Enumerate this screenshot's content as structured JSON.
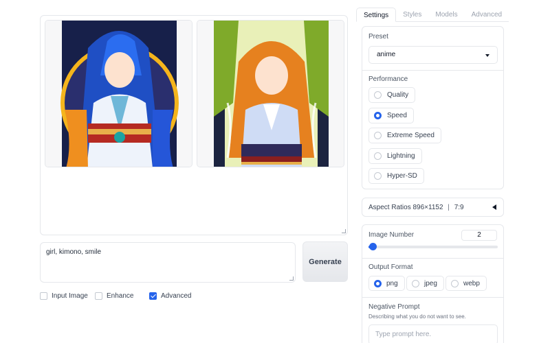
{
  "gallery": {
    "images": [
      {
        "alt": "anime girl blue hair kimono"
      },
      {
        "alt": "anime girl orange hair kimono"
      }
    ]
  },
  "prompt": {
    "value": "girl, kimono, smile"
  },
  "generate_label": "Generate",
  "options": [
    {
      "label": "Input Image",
      "checked": false
    },
    {
      "label": "Enhance",
      "checked": false
    },
    {
      "label": "Advanced",
      "checked": true
    }
  ],
  "tabs": [
    "Settings",
    "Styles",
    "Models",
    "Advanced"
  ],
  "preset": {
    "label": "Preset",
    "value": "anime"
  },
  "performance": {
    "label": "Performance",
    "options": [
      "Quality",
      "Speed",
      "Extreme Speed",
      "Lightning",
      "Hyper-SD"
    ],
    "selected": "Speed"
  },
  "aspect": {
    "label": "Aspect Ratios 896×1152",
    "sep": "|",
    "ratio": "7:9"
  },
  "image_number": {
    "label": "Image Number",
    "value": "2",
    "fraction": 0.03
  },
  "output_format": {
    "label": "Output Format",
    "options": [
      "png",
      "jpeg",
      "webp"
    ],
    "selected": "png"
  },
  "negative_prompt": {
    "label": "Negative Prompt",
    "hint": "Describing what you do not want to see.",
    "placeholder": "Type prompt here."
  },
  "colors": {
    "accent": "#2563eb"
  }
}
